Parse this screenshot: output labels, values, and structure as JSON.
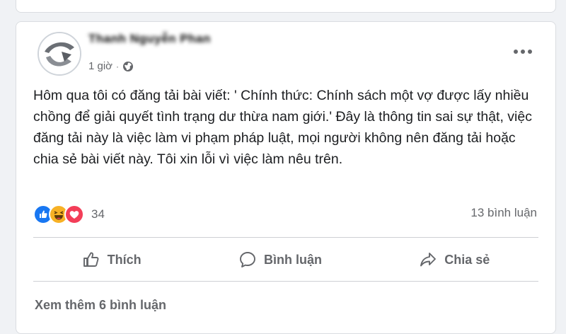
{
  "post": {
    "author": "Thanh Nguyễn Phan",
    "time": "1 giờ",
    "separator": "·",
    "privacy_icon": "globe-icon",
    "more_icon": "more-options-icon",
    "text": "Hôm qua tôi có đăng tải bài viết: ' Chính thức: Chính sách một vợ được lấy nhiều chồng để giải quyết tình trạng dư thừa nam giới.' Đây là thông tin sai sự thật, việc đăng tải này là việc làm vi phạm pháp luật, mọi người không nên đăng tải hoặc chia sẻ bài viết này. Tôi xin lỗi vì việc làm nêu trên."
  },
  "reactions": {
    "icons": [
      "like-icon",
      "haha-icon",
      "love-icon"
    ],
    "count": "34",
    "comments": "13 bình luận"
  },
  "actions": {
    "like": "Thích",
    "comment": "Bình luận",
    "share": "Chia sẻ"
  },
  "comments": {
    "see_more": "Xem thêm 6 bình luận"
  },
  "colors": {
    "background": "#f0f2f5",
    "card": "#ffffff",
    "secondary_text": "#65676b",
    "like_blue": "#1877f2",
    "love_red": "#f33e58",
    "haha_yellow": "#f7b125"
  }
}
